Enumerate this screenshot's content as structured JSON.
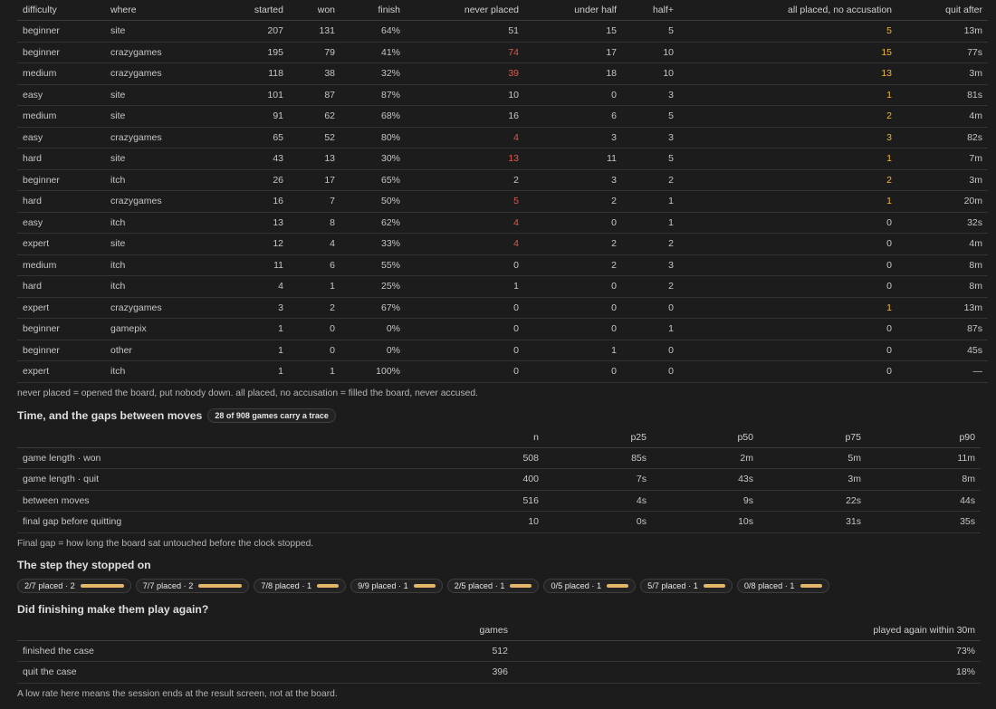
{
  "difficulty_table": {
    "headers": [
      "difficulty",
      "where",
      "started",
      "won",
      "finish",
      "never placed",
      "under half",
      "half+",
      "all placed, no accusation",
      "quit after"
    ],
    "rows": [
      {
        "difficulty": "beginner",
        "where": "site",
        "started": "207",
        "won": "131",
        "finish": "64%",
        "never_placed": "51",
        "under_half": "15",
        "half_plus": "5",
        "all_placed": "5",
        "quit_after": "13m"
      },
      {
        "difficulty": "beginner",
        "where": "crazygames",
        "started": "195",
        "won": "79",
        "finish": "41%",
        "never_placed": "74",
        "under_half": "17",
        "half_plus": "10",
        "all_placed": "15",
        "quit_after": "77s"
      },
      {
        "difficulty": "medium",
        "where": "crazygames",
        "started": "118",
        "won": "38",
        "finish": "32%",
        "never_placed": "39",
        "under_half": "18",
        "half_plus": "10",
        "all_placed": "13",
        "quit_after": "3m"
      },
      {
        "difficulty": "easy",
        "where": "site",
        "started": "101",
        "won": "87",
        "finish": "87%",
        "never_placed": "10",
        "under_half": "0",
        "half_plus": "3",
        "all_placed": "1",
        "quit_after": "81s"
      },
      {
        "difficulty": "medium",
        "where": "site",
        "started": "91",
        "won": "62",
        "finish": "68%",
        "never_placed": "16",
        "under_half": "6",
        "half_plus": "5",
        "all_placed": "2",
        "quit_after": "4m"
      },
      {
        "difficulty": "easy",
        "where": "crazygames",
        "started": "65",
        "won": "52",
        "finish": "80%",
        "never_placed": "4",
        "under_half": "3",
        "half_plus": "3",
        "all_placed": "3",
        "quit_after": "82s"
      },
      {
        "difficulty": "hard",
        "where": "site",
        "started": "43",
        "won": "13",
        "finish": "30%",
        "never_placed": "13",
        "under_half": "11",
        "half_plus": "5",
        "all_placed": "1",
        "quit_after": "7m"
      },
      {
        "difficulty": "beginner",
        "where": "itch",
        "started": "26",
        "won": "17",
        "finish": "65%",
        "never_placed": "2",
        "under_half": "3",
        "half_plus": "2",
        "all_placed": "2",
        "quit_after": "3m"
      },
      {
        "difficulty": "hard",
        "where": "crazygames",
        "started": "16",
        "won": "7",
        "finish": "50%",
        "never_placed": "5",
        "under_half": "2",
        "half_plus": "1",
        "all_placed": "1",
        "quit_after": "20m"
      },
      {
        "difficulty": "easy",
        "where": "itch",
        "started": "13",
        "won": "8",
        "finish": "62%",
        "never_placed": "4",
        "under_half": "0",
        "half_plus": "1",
        "all_placed": "0",
        "quit_after": "32s"
      },
      {
        "difficulty": "expert",
        "where": "site",
        "started": "12",
        "won": "4",
        "finish": "33%",
        "never_placed": "4",
        "under_half": "2",
        "half_plus": "2",
        "all_placed": "0",
        "quit_after": "4m"
      },
      {
        "difficulty": "medium",
        "where": "itch",
        "started": "11",
        "won": "6",
        "finish": "55%",
        "never_placed": "0",
        "under_half": "2",
        "half_plus": "3",
        "all_placed": "0",
        "quit_after": "8m"
      },
      {
        "difficulty": "hard",
        "where": "itch",
        "started": "4",
        "won": "1",
        "finish": "25%",
        "never_placed": "1",
        "under_half": "0",
        "half_plus": "2",
        "all_placed": "0",
        "quit_after": "8m"
      },
      {
        "difficulty": "expert",
        "where": "crazygames",
        "started": "3",
        "won": "2",
        "finish": "67%",
        "never_placed": "0",
        "under_half": "0",
        "half_plus": "0",
        "all_placed": "1",
        "quit_after": "13m"
      },
      {
        "difficulty": "beginner",
        "where": "gamepix",
        "started": "1",
        "won": "0",
        "finish": "0%",
        "never_placed": "0",
        "under_half": "0",
        "half_plus": "1",
        "all_placed": "0",
        "quit_after": "87s"
      },
      {
        "difficulty": "beginner",
        "where": "other",
        "started": "1",
        "won": "0",
        "finish": "0%",
        "never_placed": "0",
        "under_half": "1",
        "half_plus": "0",
        "all_placed": "0",
        "quit_after": "45s"
      },
      {
        "difficulty": "expert",
        "where": "itch",
        "started": "1",
        "won": "1",
        "finish": "100%",
        "never_placed": "0",
        "under_half": "0",
        "half_plus": "0",
        "all_placed": "0",
        "quit_after": "—"
      }
    ],
    "note": "never placed = opened the board, put nobody down. all placed, no accusation = filled the board, never accused."
  },
  "timing": {
    "title": "Time, and the gaps between moves",
    "badge": "28 of 908 games carry a trace",
    "headers": [
      "",
      "n",
      "p25",
      "p50",
      "p75",
      "p90"
    ],
    "rows": [
      {
        "label": "game length · won",
        "n": "508",
        "p25": "85s",
        "p50": "2m",
        "p75": "5m",
        "p90": "11m"
      },
      {
        "label": "game length · quit",
        "n": "400",
        "p25": "7s",
        "p50": "43s",
        "p75": "3m",
        "p90": "8m"
      },
      {
        "label": "between moves",
        "n": "516",
        "p25": "4s",
        "p50": "9s",
        "p75": "22s",
        "p90": "44s"
      },
      {
        "label": "final gap before quitting",
        "n": "10",
        "p25": "0s",
        "p50": "10s",
        "p75": "31s",
        "p90": "35s"
      }
    ],
    "note": "Final gap = how long the board sat untouched before the clock stopped."
  },
  "stopped": {
    "title": "The step they stopped on",
    "bar_color": "#e3b66a",
    "pills": [
      {
        "label": "2/7 placed · 2",
        "count": 2
      },
      {
        "label": "7/7 placed · 2",
        "count": 2
      },
      {
        "label": "7/8 placed · 1",
        "count": 1
      },
      {
        "label": "9/9 placed · 1",
        "count": 1
      },
      {
        "label": "2/5 placed · 1",
        "count": 1
      },
      {
        "label": "0/5 placed · 1",
        "count": 1
      },
      {
        "label": "5/7 placed · 1",
        "count": 1
      },
      {
        "label": "0/8 placed · 1",
        "count": 1
      }
    ]
  },
  "replay": {
    "title": "Did finishing make them play again?",
    "headers": [
      "",
      "games",
      "played again within 30m"
    ],
    "rows": [
      {
        "label": "finished the case",
        "games": "512",
        "rate": "73%"
      },
      {
        "label": "quit the case",
        "games": "396",
        "rate": "18%"
      }
    ],
    "note": "A low rate here means the session ends at the result screen, not at the board."
  }
}
